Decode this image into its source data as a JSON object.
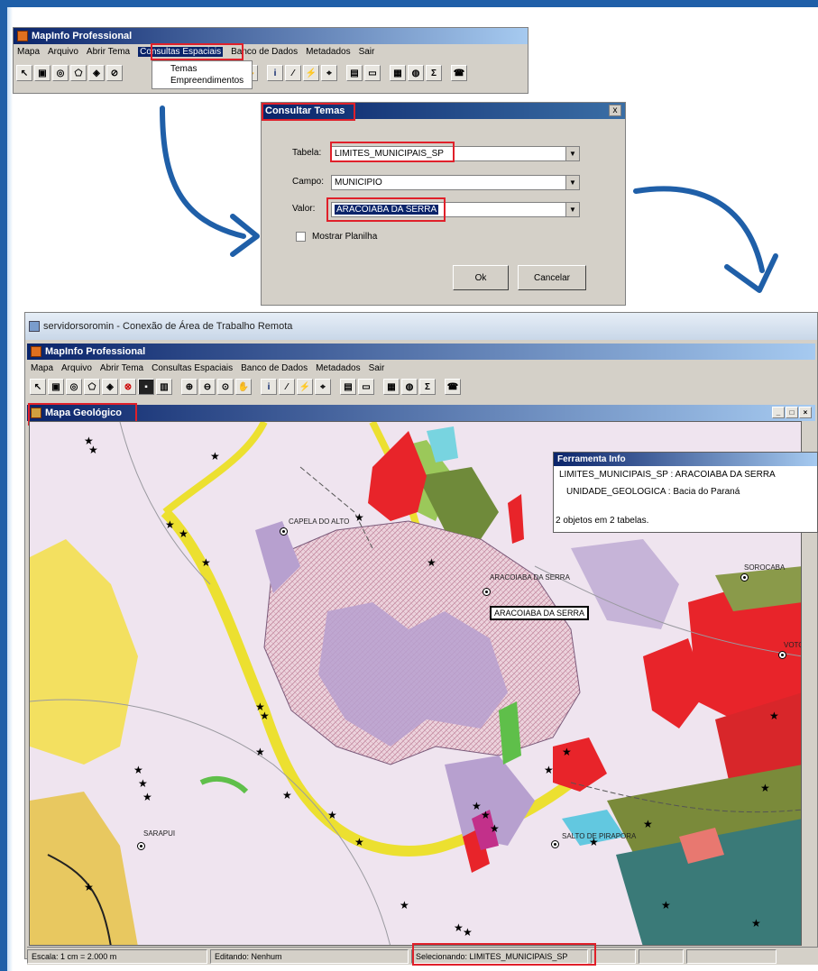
{
  "top_window": {
    "title": "MapInfo Professional",
    "menu": [
      "Mapa",
      "Arquivo",
      "Abrir Tema",
      "Consultas Espaciais",
      "Banco de Dados",
      "Metadados",
      "Sair"
    ],
    "dropdown_items": [
      "Temas",
      "Empreendimentos"
    ]
  },
  "dialog": {
    "title": "Consultar Temas",
    "tabela_label": "Tabela:",
    "tabela_value": "LIMITES_MUNICIPAIS_SP",
    "campo_label": "Campo:",
    "campo_value": "MUNICIPIO",
    "valor_label": "Valor:",
    "valor_value": "ARACOIABA DA SERRA",
    "checkbox_label": "Mostrar Planilha",
    "ok_label": "Ok",
    "cancel_label": "Cancelar",
    "close_label": "x"
  },
  "remote": {
    "title": "servidorsoromin - Conexão de Área de Trabalho Remota",
    "app_title": "MapInfo Professional",
    "menu": [
      "Mapa",
      "Arquivo",
      "Abrir Tema",
      "Consultas Espaciais",
      "Banco de Dados",
      "Metadados",
      "Sair"
    ],
    "map_window_title": "Mapa Geológico"
  },
  "info_tool": {
    "title": "Ferramenta Info",
    "line1": "LIMITES_MUNICIPAIS_SP : ARACOIABA DA SERRA",
    "line2": "UNIDADE_GEOLOGICA : Bacia do Paraná",
    "summary": "2 objetos em 2 tabelas."
  },
  "map_labels": {
    "capela": "CAPELA DO ALTO",
    "aracoiaba": "ARACOIABA DA SERRA",
    "aracoiaba_selected": "ARACOIABA DA SERRA",
    "sorocaba": "SOROCABA",
    "votorantim": "VOTO",
    "sarapui": "SARAPUI",
    "salto": "SALTO DE PIRAPORA"
  },
  "status": {
    "scale": "Escala: 1 cm = 2.000 m",
    "editing": "Editando: Nenhum",
    "selecting": "Selecionando: LIMITES_MUNICIPAIS_SP"
  },
  "colors": {
    "highlight_red": "#e0202a",
    "arrow_blue": "#1f5fa8",
    "titlebar_blue": "#0a246a"
  }
}
